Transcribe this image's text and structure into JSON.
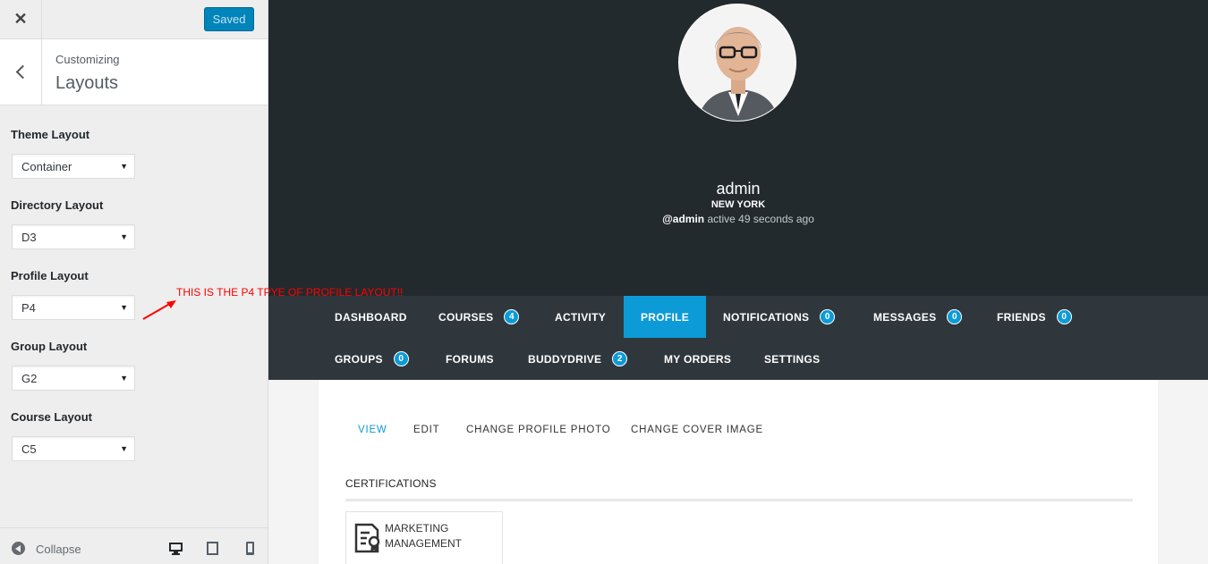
{
  "sidebar": {
    "close_icon": "close-icon",
    "save_button": "Saved",
    "header": {
      "subtitle": "Customizing",
      "title": "Layouts"
    },
    "controls": [
      {
        "label": "Theme Layout",
        "value": "Container"
      },
      {
        "label": "Directory Layout",
        "value": "D3"
      },
      {
        "label": "Profile Layout",
        "value": "P4"
      },
      {
        "label": "Group Layout",
        "value": "G2"
      },
      {
        "label": "Course Layout",
        "value": "C5"
      }
    ],
    "footer": {
      "collapse_label": "Collapse",
      "devices": [
        "desktop-icon",
        "tablet-icon",
        "mobile-icon"
      ]
    }
  },
  "annotation": {
    "text": "THIS IS THE P4 TPYE OF PROFILE LAYOUT!!",
    "color": "#ff0000"
  },
  "profile": {
    "name": "admin",
    "location": "NEW YORK",
    "handle": "@admin",
    "activity": "active 49 seconds ago",
    "nav": [
      {
        "label": "DASHBOARD"
      },
      {
        "label": "COURSES",
        "count": "4"
      },
      {
        "label": "ACTIVITY"
      },
      {
        "label": "PROFILE",
        "active": true
      },
      {
        "label": "NOTIFICATIONS",
        "count": "0"
      },
      {
        "label": "MESSAGES",
        "count": "0"
      },
      {
        "label": "FRIENDS",
        "count": "0"
      },
      {
        "label": "GROUPS",
        "count": "0"
      },
      {
        "label": "FORUMS"
      },
      {
        "label": "BUDDYDRIVE",
        "count": "2"
      },
      {
        "label": "MY ORDERS"
      },
      {
        "label": "SETTINGS"
      }
    ],
    "subnav": [
      {
        "label": "VIEW",
        "active": true
      },
      {
        "label": "EDIT"
      },
      {
        "label": "CHANGE PROFILE PHOTO"
      },
      {
        "label": "CHANGE COVER IMAGE"
      }
    ],
    "certifications": {
      "heading": "CERTIFICATIONS",
      "items": [
        {
          "title": "MARKETING MANAGEMENT",
          "icon": "certificate-icon"
        }
      ]
    }
  },
  "colors": {
    "accent": "#0d9bd7",
    "cover": "#232a2d",
    "navbar": "#30373c",
    "saved_button": "#0085ba"
  }
}
